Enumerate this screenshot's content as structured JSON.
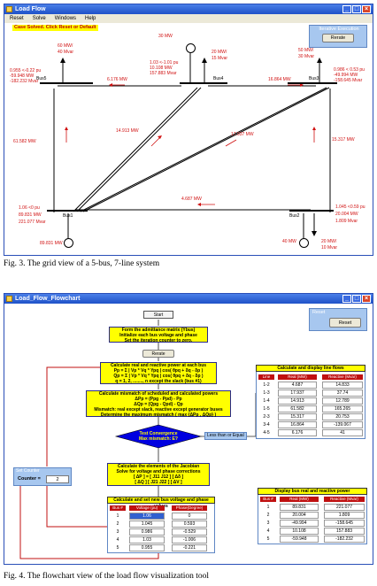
{
  "win1": {
    "title": "Load Flow",
    "menu": [
      "Reset",
      "Solve",
      "Windows",
      "Help"
    ],
    "status": "Case Solved. Click Reset or Default",
    "iter_panel": {
      "title": "Iterative Execution",
      "button": "Rerate"
    },
    "buses": {
      "bus1": {
        "name": "Bus1",
        "voltage": "1.06 <0 pu",
        "p": "89.831 MW",
        "q": "221.077 Mvar",
        "gen": "89.831 MW"
      },
      "bus2": {
        "name": "Bus2",
        "voltage": "1.045 <0.59 pu",
        "p": "20.004 MW",
        "q": "1.809 Mvar",
        "load_p": "20 MW/",
        "load_q": "10 Mvar",
        "gen": "40 MW"
      },
      "bus3": {
        "name": "Bus3",
        "voltage": "0.986 < 0.53 pu",
        "p": "-49.994 MW",
        "q": "-158.645 Mvar",
        "load_p": "50 MW/",
        "load_q": "30 Mvar"
      },
      "bus4": {
        "name": "Bus4",
        "voltage": "1.03 <-1.01 pu",
        "p": "10.108 MW",
        "q": "157.883 Mvar",
        "load_p": "20 MW/",
        "load_q": "15 Mvar",
        "gen": "30 MW"
      },
      "bus5": {
        "name": "Bus5",
        "voltage": "0.955 <-0.22 pu",
        "p": "-59.948 MW",
        "q": "-182.232 Mvar",
        "load_p": "60 MW/",
        "load_q": "40 Mvar"
      }
    },
    "flows": {
      "f54": "6.176 MW",
      "f43": "16.864 MW",
      "f51": "61.582 MW",
      "f41": "14.913 MW",
      "f31": "17.937 MW",
      "f32": "15.317 MW",
      "f12": "4.687 MW"
    }
  },
  "caption1": "Fig. 3. The grid view of a 5-bus, 7-line system",
  "win2": {
    "title": "Load_Flow_Flowchart",
    "reset_panel": {
      "title": "Reset",
      "button": "Reset"
    },
    "start": "Start",
    "step1": [
      "Form the admittance matrix (Ybus)",
      "Initialize each bus voltage and phase",
      "Set the iteration counter to zero."
    ],
    "rerate_btn": "Rerate",
    "step2": [
      "Calculate real and reactive power at each bus",
      "Pp = Σ | Vp * Vq * Ypq | cos( θpq + δq - δp )",
      "Qp = Σ | Vp * Vq * Ypq | cos( θpq + δq - δp )",
      "q = 1, 2, ........, n except the slack (bus #1)"
    ],
    "step3": [
      "Calculate mismatch of scheduled and calculated powers",
      "ΔPp = (Ppg - Ppd) - Pp",
      "ΔQp = (Qpg - Qpd) - Qp",
      "Mismatch: real except slack, reactive except generator buses",
      "Determine the maximum mismatch ( max {ΔPp , ΔQp} )"
    ],
    "decision": [
      "Test Convergence",
      "Max mismatch: E?"
    ],
    "less_equal": "Less than or Equal",
    "step4": [
      "Calculate the elements of the Jacobian",
      "Solve for voltage and phase corrections",
      "[ ΔP ]  =  [ J11   J12 ] [ Δδ ]",
      "[ ΔQ ]       [ J21   J22 ] [ ΔV ]"
    ],
    "counter_panel": {
      "title": "Set Counter",
      "label": "Counter =",
      "value": "2"
    },
    "voltage_table": {
      "title": "Calculate and set new bus voltage and phase values",
      "headers": [
        "Bus #",
        "Voltage (pu)",
        "Phase(Degree)"
      ],
      "rows": [
        [
          "1",
          "1.06",
          "0"
        ],
        [
          "2",
          "1.045",
          "0.593"
        ],
        [
          "3",
          "0.986",
          "-0.529"
        ],
        [
          "4",
          "1.03",
          "-1.006"
        ],
        [
          "5",
          "0.955",
          "-0.221"
        ]
      ]
    },
    "line_table": {
      "title": "Calculate and display line flows",
      "headers": [
        "Line",
        "Real (MW)",
        "Reactive (Mvar)"
      ],
      "rows": [
        [
          "1-2",
          "4.687",
          "14.833"
        ],
        [
          "1-3",
          "17.937",
          "37.74"
        ],
        [
          "1-4",
          "14.913",
          "12.789"
        ],
        [
          "1-5",
          "61.582",
          "165.265"
        ],
        [
          "2-3",
          "15.317",
          "20.753"
        ],
        [
          "3-4",
          "16.864",
          "-139.067"
        ],
        [
          "4-5",
          "6.176",
          "41"
        ]
      ]
    },
    "power_table": {
      "title": "Display bus real and reactive power",
      "headers": [
        "Bus #",
        "Real (MW)",
        "Reactive (Mvar)"
      ],
      "rows": [
        [
          "1",
          "89.831",
          "221.077"
        ],
        [
          "2",
          "20.004",
          "1.809"
        ],
        [
          "3",
          "-49.994",
          "-158.645"
        ],
        [
          "4",
          "10.108",
          "157.883"
        ],
        [
          "5",
          "-59.948",
          "-182.232"
        ]
      ]
    }
  },
  "caption2": "Fig. 4. The flowchart view of the load flow visualization tool"
}
